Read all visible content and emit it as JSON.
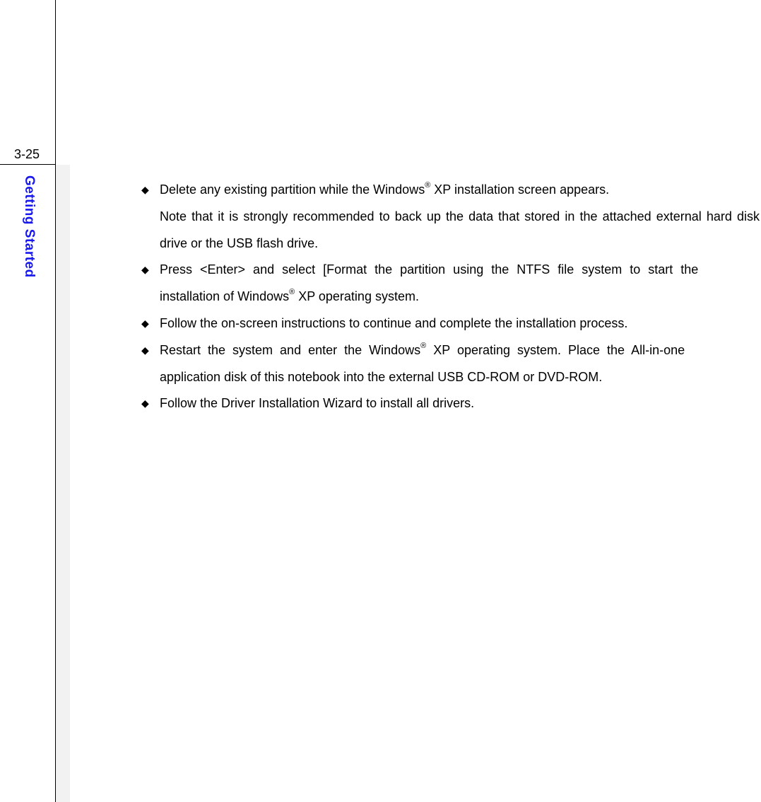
{
  "pageNumber": "3-25",
  "sectionLabel": "Getting Started",
  "bullets": [
    {
      "pre1": "Delete any existing partition while the Windows",
      "sup1": "®",
      "post1": " XP installation screen appears.",
      "line2": "Note that it is strongly recommended to back up the data that stored in the attached external hard disk drive or the USB flash drive."
    },
    {
      "line1": "Press <Enter> and select [Format the partition using the NTFS file system to start the",
      "pre2": "installation of Windows",
      "sup2": "®",
      "post2": " XP operating system."
    },
    {
      "line1": "Follow the on-screen instructions to continue and complete the installation process."
    },
    {
      "pre1": "Restart the system and enter the Windows",
      "sup1": "®",
      "post1": " XP operating system.  Place the All-in-one",
      "line2": "application disk of this notebook into the external USB CD-ROM or DVD-ROM."
    },
    {
      "line1": "Follow the Driver Installation Wizard to install all drivers."
    }
  ]
}
